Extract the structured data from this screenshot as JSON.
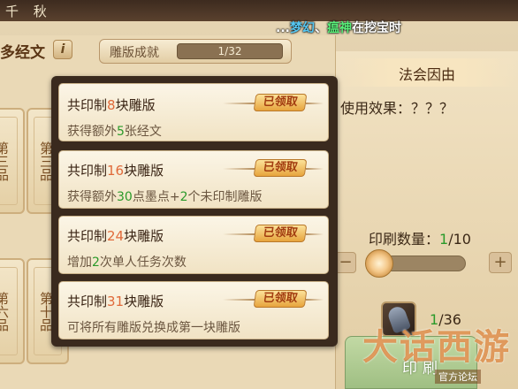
{
  "topbar": {
    "title": "千 秋"
  },
  "scroll_msg": {
    "prefix": "...",
    "name1": "梦幻",
    "sep": "、",
    "name2": "瘟神",
    "suffix": "在挖宝时"
  },
  "left": {
    "title": "多经文",
    "info_icon": "i",
    "achievement_label": "雕版成就",
    "achievement_value": "1/32",
    "tiles_top": [
      "第三品",
      "第三品"
    ],
    "tiles_bottom": [
      "第六品",
      "第十品"
    ]
  },
  "popup": {
    "cards": [
      {
        "title_pre": "共印制",
        "num": "8",
        "title_post": "块雕版",
        "status": "已领取",
        "desc_pre": "获得额外",
        "desc_num1": "5",
        "desc_mid": "张经文",
        "desc_num2": "",
        "desc_post": ""
      },
      {
        "title_pre": "共印制",
        "num": "16",
        "title_post": "块雕版",
        "status": "已领取",
        "desc_pre": "获得额外",
        "desc_num1": "30",
        "desc_mid": "点墨点+",
        "desc_num2": "2",
        "desc_post": "个未印制雕版"
      },
      {
        "title_pre": "共印制",
        "num": "24",
        "title_post": "块雕版",
        "status": "已领取",
        "desc_pre": "增加",
        "desc_num1": "2",
        "desc_mid": "次单人任务次数",
        "desc_num2": "",
        "desc_post": ""
      },
      {
        "title_pre": "共印制",
        "num": "31",
        "title_post": "块雕版",
        "status": "已领取",
        "desc_pre": "可将所有雕版兑换成第一块雕版",
        "desc_num1": "",
        "desc_mid": "",
        "desc_num2": "",
        "desc_post": ""
      }
    ]
  },
  "right": {
    "title": "法会因由",
    "effect": "使用效果：？？？",
    "print_label": "印刷数量：",
    "print_current": "1",
    "print_total": "/10",
    "minus": "−",
    "plus": "+",
    "item_current": "1",
    "item_total": "/36",
    "print_button": "印刷",
    "watermark": "大话西游",
    "watermark_sub": "官方论坛"
  }
}
